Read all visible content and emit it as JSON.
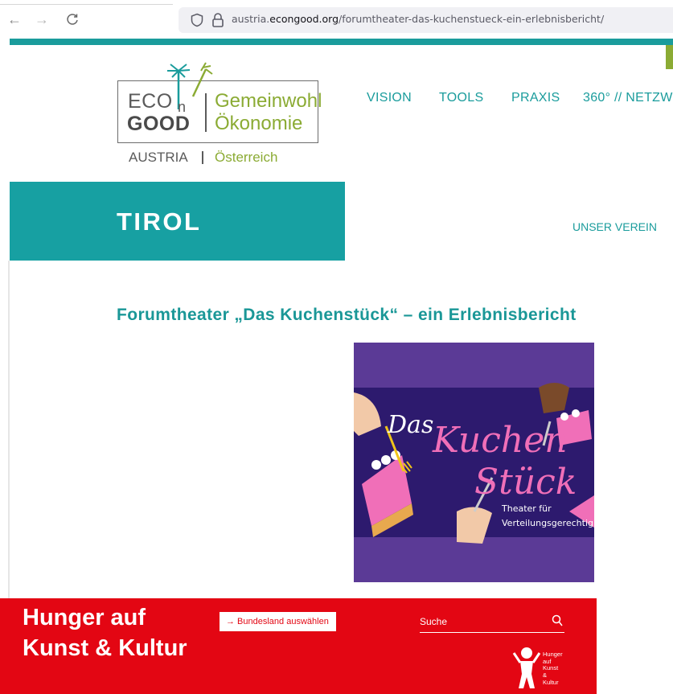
{
  "browser": {
    "url_prefix": "austria.",
    "url_domain": "econgood.org",
    "url_path": "/forumtheater-das-kuchenstueck-ein-erlebnisbericht/",
    "back_glyph": "←",
    "forward_glyph": "→",
    "reload_glyph": "C"
  },
  "logo": {
    "eco": "ECO",
    "n": "n",
    "good": "GOOD",
    "gemeinwohl": "Gemeinwohl",
    "oekonomie": "Ökonomie",
    "austria": "AUSTRIA",
    "oesterreich": "Österreich"
  },
  "nav": {
    "items": [
      "VISION",
      "TOOLS",
      "PRAXIS",
      "360° // NETZW"
    ]
  },
  "section": {
    "title": "TIROL",
    "sub_nav": "UNSER VEREIN"
  },
  "article": {
    "title": "Forumtheater „Das Kuchenstück“ – ein Erlebnisbericht",
    "poster": {
      "das": "Das",
      "kuchen": "Kuchen",
      "stueck": "Stück",
      "theater": "Theater für",
      "verteilung": "Verteilungsgerechtig"
    }
  },
  "footer": {
    "line1": "Hunger auf",
    "line2": "Kunst & Kultur",
    "region_button": "→ Bundesland auswählen",
    "search_label": "Suche",
    "mini_logo": [
      "Hunger",
      "auf",
      "Kunst",
      "&",
      "Kultur"
    ]
  },
  "colors": {
    "teal": "#1a9c9c",
    "green": "#8bab34",
    "footer_red": "#e30613",
    "poster_purple": "#5b3a96"
  }
}
